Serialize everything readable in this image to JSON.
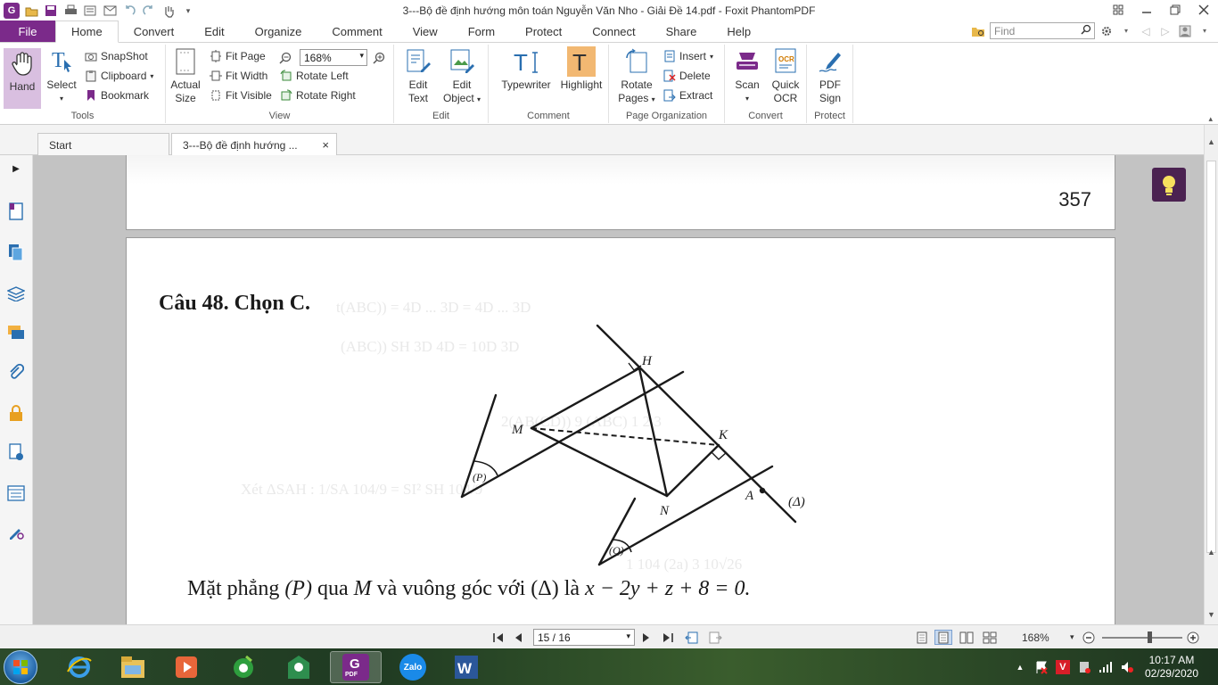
{
  "window": {
    "title": "3---Bộ đề định hướng môn toán Nguyễn Văn Nho - Giải Đề 14.pdf - Foxit PhantomPDF"
  },
  "menu": {
    "file": "File",
    "tabs": [
      "Home",
      "Convert",
      "Edit",
      "Organize",
      "Comment",
      "View",
      "Form",
      "Protect",
      "Connect",
      "Share",
      "Help"
    ],
    "active_tab": "Home",
    "find_placeholder": "Find"
  },
  "ribbon": {
    "tools": {
      "label": "Tools",
      "hand": "Hand",
      "select": "Select",
      "snapshot": "SnapShot",
      "clipboard": "Clipboard",
      "bookmark": "Bookmark"
    },
    "view": {
      "label": "View",
      "actual_size_1": "Actual",
      "actual_size_2": "Size",
      "fit_page": "Fit Page",
      "fit_width": "Fit Width",
      "fit_visible": "Fit Visible",
      "zoom_value": "168%",
      "rotate_left": "Rotate Left",
      "rotate_right": "Rotate Right"
    },
    "edit": {
      "label": "Edit",
      "edit_text_1": "Edit",
      "edit_text_2": "Text",
      "edit_object_1": "Edit",
      "edit_object_2": "Object"
    },
    "comment": {
      "label": "Comment",
      "typewriter": "Typewriter",
      "highlight": "Highlight"
    },
    "page_org": {
      "label": "Page Organization",
      "rotate_pages_1": "Rotate",
      "rotate_pages_2": "Pages",
      "insert": "Insert",
      "delete": "Delete",
      "extract": "Extract"
    },
    "convert": {
      "label": "Convert",
      "scan": "Scan",
      "quick_ocr_1": "Quick",
      "quick_ocr_2": "OCR",
      "ocr_badge": "OCR"
    },
    "protect": {
      "label": "Protect",
      "pdf_sign_1": "PDF",
      "pdf_sign_2": "Sign"
    }
  },
  "doc_tabs": {
    "start": "Start",
    "current": "3---Bộ đề định hướng ...",
    "close": "×"
  },
  "document": {
    "page_number": "357",
    "question_heading": "Câu 48. Chọn C.",
    "sentence": {
      "part1": "Mặt phẳng",
      "P": "(P)",
      "part2": "qua",
      "M": "M",
      "part3": "và vuông góc với",
      "delta": "(Δ)",
      "part4": "là",
      "equation": "x − 2y + z + 8 = 0."
    },
    "figure_labels": {
      "H": "H",
      "M": "M",
      "K": "K",
      "N": "N",
      "A": "A",
      "P": "(P)",
      "Q": "(Q)",
      "delta": "(Δ)"
    }
  },
  "statusbar": {
    "page_display": "15 / 16",
    "zoom": "168%"
  },
  "taskbar": {
    "zalo": "Zalo",
    "pdf_badge": "PDF",
    "clock_time": "10:17 AM",
    "clock_date": "02/29/2020"
  },
  "colors": {
    "accent": "#7b2a8a",
    "tip_button": "#4b2251",
    "viewer_bg": "#c3c3c3"
  }
}
